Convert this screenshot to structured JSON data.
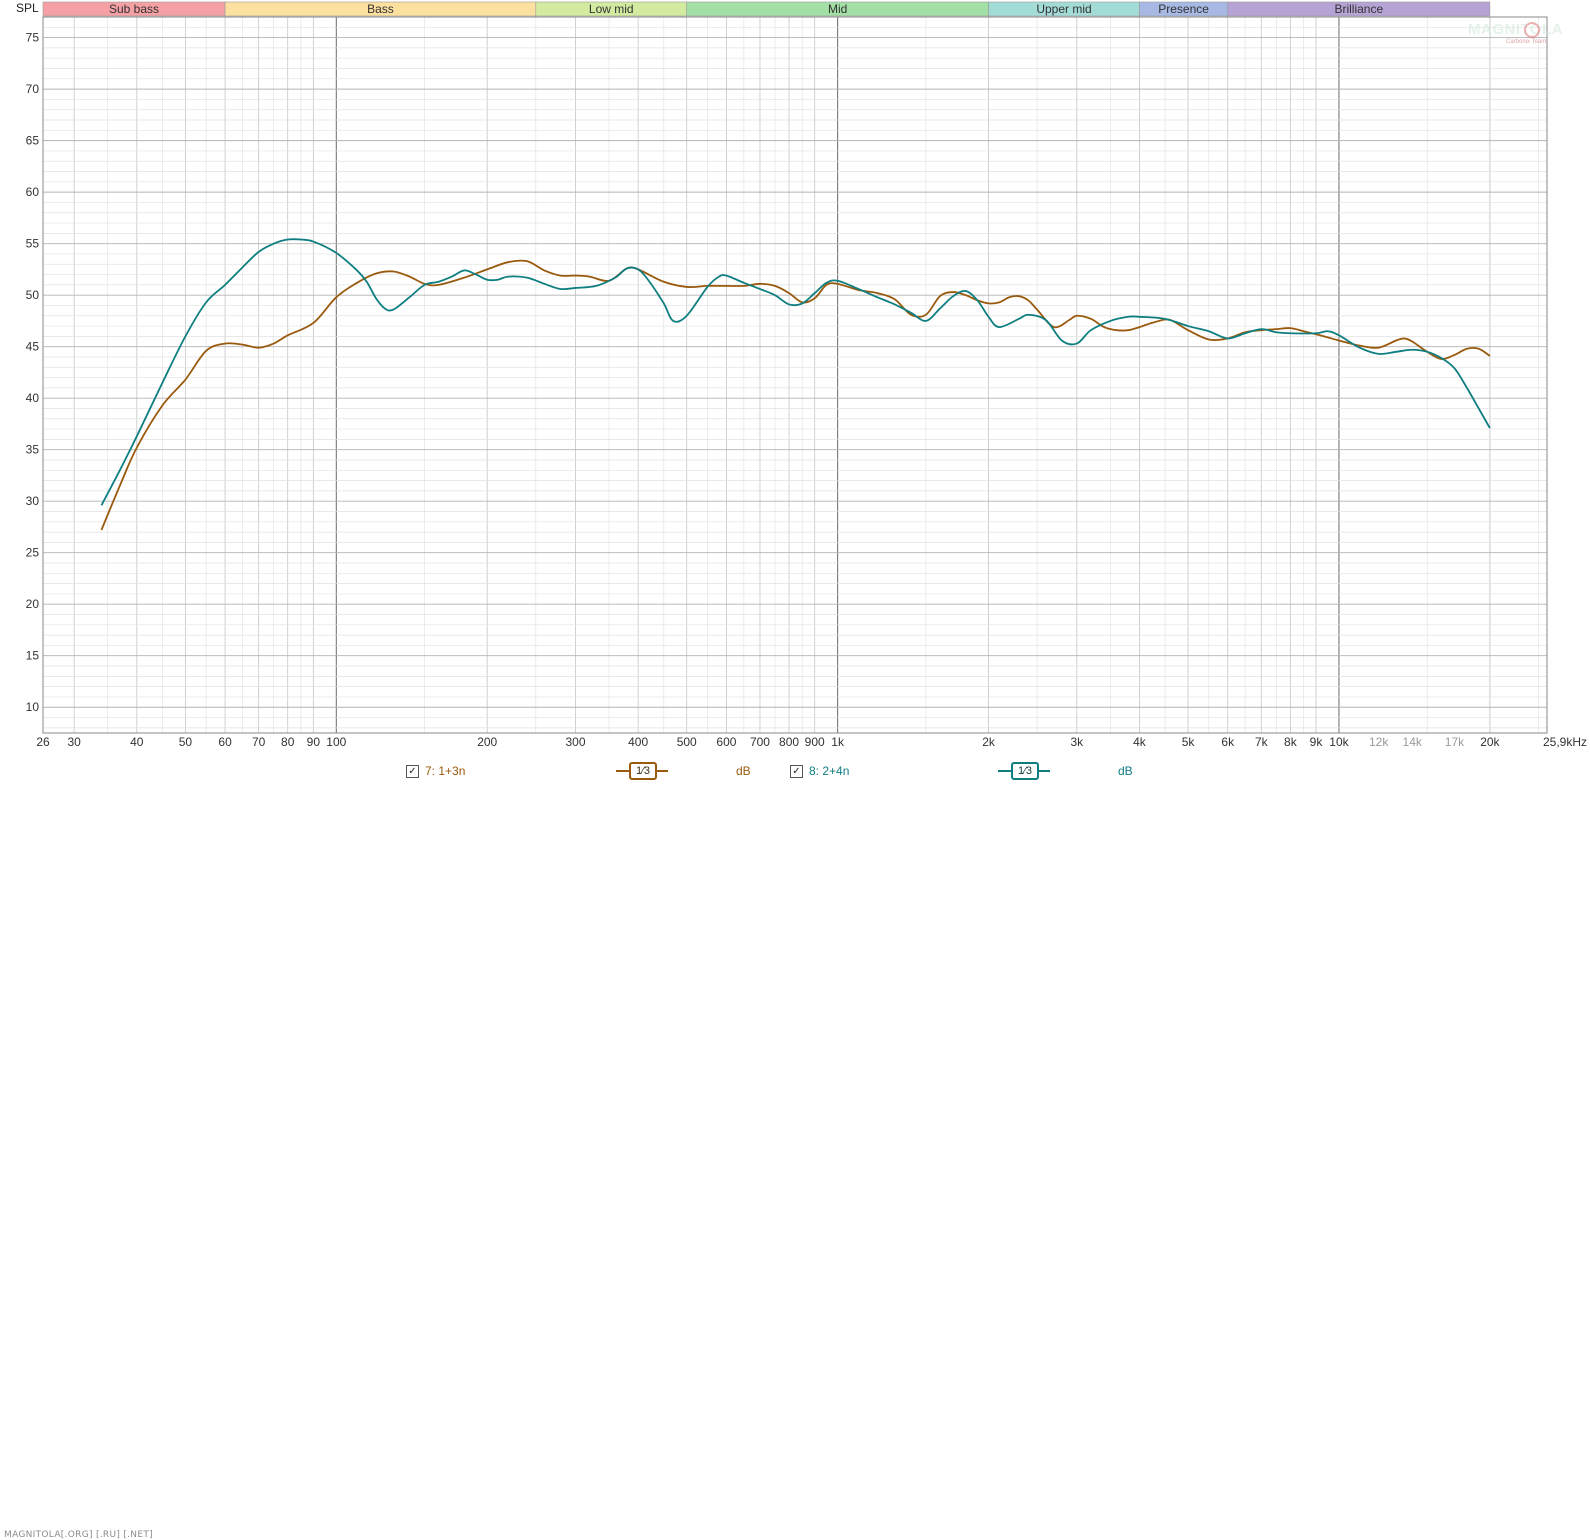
{
  "chart_data": {
    "type": "line",
    "y_axis_label": "SPL",
    "x_scale": "log",
    "xlim": [
      26,
      26000
    ],
    "ylim": [
      7.5,
      77
    ],
    "y_ticks": [
      10,
      15,
      20,
      25,
      30,
      35,
      40,
      45,
      50,
      55,
      60,
      65,
      70,
      75
    ],
    "x_tick_labels": [
      {
        "value": 26,
        "label": "26"
      },
      {
        "value": 30,
        "label": "30"
      },
      {
        "value": 40,
        "label": "40"
      },
      {
        "value": 50,
        "label": "50"
      },
      {
        "value": 60,
        "label": "60"
      },
      {
        "value": 70,
        "label": "70"
      },
      {
        "value": 80,
        "label": "80"
      },
      {
        "value": 90,
        "label": "90"
      },
      {
        "value": 100,
        "label": "100"
      },
      {
        "value": 200,
        "label": "200"
      },
      {
        "value": 300,
        "label": "300"
      },
      {
        "value": 400,
        "label": "400"
      },
      {
        "value": 500,
        "label": "500"
      },
      {
        "value": 600,
        "label": "600"
      },
      {
        "value": 700,
        "label": "700"
      },
      {
        "value": 800,
        "label": "800"
      },
      {
        "value": 900,
        "label": "900"
      },
      {
        "value": 1000,
        "label": "1k"
      },
      {
        "value": 2000,
        "label": "2k"
      },
      {
        "value": 3000,
        "label": "3k"
      },
      {
        "value": 4000,
        "label": "4k"
      },
      {
        "value": 5000,
        "label": "5k"
      },
      {
        "value": 6000,
        "label": "6k"
      },
      {
        "value": 7000,
        "label": "7k"
      },
      {
        "value": 8000,
        "label": "8k"
      },
      {
        "value": 9000,
        "label": "9k"
      },
      {
        "value": 10000,
        "label": "10k"
      },
      {
        "value": 12000,
        "label": "12k",
        "dim": true
      },
      {
        "value": 14000,
        "label": "14k",
        "dim": true
      },
      {
        "value": 17000,
        "label": "17k",
        "dim": true
      },
      {
        "value": 20000,
        "label": "20k"
      },
      {
        "value": 25900,
        "label": "25,9kHz"
      }
    ],
    "bands": [
      {
        "name": "Sub bass",
        "from": 26,
        "to": 60,
        "color": "#f4a0a4"
      },
      {
        "name": "Bass",
        "from": 60,
        "to": 250,
        "color": "#fce0a0"
      },
      {
        "name": "Low mid",
        "from": 250,
        "to": 500,
        "color": "#d2eba0"
      },
      {
        "name": "Mid",
        "from": 500,
        "to": 2000,
        "color": "#a3e0a6"
      },
      {
        "name": "Upper mid",
        "from": 2000,
        "to": 4000,
        "color": "#a3dcd6"
      },
      {
        "name": "Presence",
        "from": 4000,
        "to": 6000,
        "color": "#a6b8e3"
      },
      {
        "name": "Brilliance",
        "from": 6000,
        "to": 20000,
        "color": "#b6a3d6"
      }
    ],
    "series": [
      {
        "name": "7: 1+3n",
        "color": "#9a5a0e",
        "points": [
          [
            34,
            27.2
          ],
          [
            37,
            31.5
          ],
          [
            40,
            35.2
          ],
          [
            45,
            39.3
          ],
          [
            50,
            41.8
          ],
          [
            55,
            44.6
          ],
          [
            60,
            45.3
          ],
          [
            65,
            45.2
          ],
          [
            70,
            44.9
          ],
          [
            75,
            45.3
          ],
          [
            80,
            46.1
          ],
          [
            90,
            47.3
          ],
          [
            100,
            49.8
          ],
          [
            110,
            51.2
          ],
          [
            120,
            52.1
          ],
          [
            130,
            52.3
          ],
          [
            140,
            51.8
          ],
          [
            150,
            51.1
          ],
          [
            160,
            51.0
          ],
          [
            180,
            51.7
          ],
          [
            200,
            52.5
          ],
          [
            220,
            53.2
          ],
          [
            240,
            53.3
          ],
          [
            260,
            52.4
          ],
          [
            280,
            51.9
          ],
          [
            300,
            51.9
          ],
          [
            320,
            51.8
          ],
          [
            350,
            51.4
          ],
          [
            380,
            52.6
          ],
          [
            400,
            52.5
          ],
          [
            450,
            51.3
          ],
          [
            500,
            50.8
          ],
          [
            550,
            50.9
          ],
          [
            600,
            50.9
          ],
          [
            650,
            50.9
          ],
          [
            700,
            51.1
          ],
          [
            750,
            50.9
          ],
          [
            800,
            50.2
          ],
          [
            850,
            49.3
          ],
          [
            900,
            49.7
          ],
          [
            950,
            51.0
          ],
          [
            1000,
            51.1
          ],
          [
            1100,
            50.5
          ],
          [
            1200,
            50.2
          ],
          [
            1300,
            49.6
          ],
          [
            1400,
            48.1
          ],
          [
            1500,
            48.1
          ],
          [
            1600,
            49.9
          ],
          [
            1700,
            50.3
          ],
          [
            1800,
            50.0
          ],
          [
            1900,
            49.5
          ],
          [
            2000,
            49.2
          ],
          [
            2100,
            49.3
          ],
          [
            2200,
            49.8
          ],
          [
            2300,
            49.9
          ],
          [
            2400,
            49.5
          ],
          [
            2500,
            48.6
          ],
          [
            2700,
            46.9
          ],
          [
            2900,
            47.6
          ],
          [
            3000,
            48.0
          ],
          [
            3200,
            47.7
          ],
          [
            3400,
            46.9
          ],
          [
            3600,
            46.6
          ],
          [
            3800,
            46.6
          ],
          [
            4000,
            46.9
          ],
          [
            4300,
            47.4
          ],
          [
            4600,
            47.6
          ],
          [
            5000,
            46.6
          ],
          [
            5500,
            45.7
          ],
          [
            6000,
            45.8
          ],
          [
            6500,
            46.4
          ],
          [
            7000,
            46.6
          ],
          [
            7500,
            46.7
          ],
          [
            8000,
            46.8
          ],
          [
            8500,
            46.5
          ],
          [
            9000,
            46.2
          ],
          [
            9500,
            45.9
          ],
          [
            10000,
            45.6
          ],
          [
            11000,
            45.1
          ],
          [
            12000,
            44.9
          ],
          [
            13000,
            45.6
          ],
          [
            13500,
            45.8
          ],
          [
            14000,
            45.5
          ],
          [
            15000,
            44.5
          ],
          [
            16000,
            43.8
          ],
          [
            17000,
            44.2
          ],
          [
            18000,
            44.8
          ],
          [
            19000,
            44.8
          ],
          [
            20000,
            44.1
          ]
        ]
      },
      {
        "name": "8: 2+4n",
        "color": "#0e7e80",
        "points": [
          [
            34,
            29.6
          ],
          [
            37,
            33.0
          ],
          [
            40,
            36.3
          ],
          [
            45,
            41.5
          ],
          [
            50,
            46.0
          ],
          [
            55,
            49.3
          ],
          [
            60,
            51.0
          ],
          [
            65,
            52.7
          ],
          [
            70,
            54.2
          ],
          [
            75,
            55.0
          ],
          [
            80,
            55.4
          ],
          [
            85,
            55.4
          ],
          [
            90,
            55.2
          ],
          [
            100,
            54.1
          ],
          [
            110,
            52.4
          ],
          [
            115,
            51.3
          ],
          [
            120,
            49.7
          ],
          [
            125,
            48.7
          ],
          [
            130,
            48.6
          ],
          [
            140,
            49.8
          ],
          [
            150,
            51.0
          ],
          [
            160,
            51.3
          ],
          [
            170,
            51.8
          ],
          [
            180,
            52.4
          ],
          [
            190,
            52.0
          ],
          [
            200,
            51.5
          ],
          [
            210,
            51.5
          ],
          [
            220,
            51.8
          ],
          [
            240,
            51.7
          ],
          [
            260,
            51.1
          ],
          [
            280,
            50.6
          ],
          [
            300,
            50.7
          ],
          [
            330,
            50.9
          ],
          [
            360,
            51.7
          ],
          [
            380,
            52.6
          ],
          [
            400,
            52.5
          ],
          [
            420,
            51.4
          ],
          [
            450,
            49.2
          ],
          [
            470,
            47.5
          ],
          [
            500,
            48.0
          ],
          [
            550,
            50.8
          ],
          [
            580,
            51.8
          ],
          [
            600,
            51.9
          ],
          [
            650,
            51.2
          ],
          [
            700,
            50.6
          ],
          [
            750,
            50.0
          ],
          [
            800,
            49.1
          ],
          [
            850,
            49.2
          ],
          [
            900,
            50.2
          ],
          [
            950,
            51.2
          ],
          [
            1000,
            51.4
          ],
          [
            1100,
            50.6
          ],
          [
            1200,
            49.8
          ],
          [
            1300,
            49.1
          ],
          [
            1400,
            48.3
          ],
          [
            1500,
            47.5
          ],
          [
            1600,
            48.7
          ],
          [
            1700,
            49.9
          ],
          [
            1800,
            50.4
          ],
          [
            1900,
            49.5
          ],
          [
            2000,
            47.9
          ],
          [
            2100,
            46.9
          ],
          [
            2300,
            47.7
          ],
          [
            2400,
            48.1
          ],
          [
            2600,
            47.6
          ],
          [
            2800,
            45.6
          ],
          [
            3000,
            45.3
          ],
          [
            3200,
            46.6
          ],
          [
            3500,
            47.5
          ],
          [
            3800,
            47.9
          ],
          [
            4000,
            47.9
          ],
          [
            4500,
            47.7
          ],
          [
            5000,
            47.0
          ],
          [
            5500,
            46.5
          ],
          [
            6000,
            45.8
          ],
          [
            6500,
            46.3
          ],
          [
            7000,
            46.7
          ],
          [
            7500,
            46.4
          ],
          [
            8000,
            46.3
          ],
          [
            9000,
            46.3
          ],
          [
            9500,
            46.5
          ],
          [
            10000,
            46.1
          ],
          [
            11000,
            44.9
          ],
          [
            12000,
            44.3
          ],
          [
            13000,
            44.5
          ],
          [
            14000,
            44.7
          ],
          [
            15000,
            44.5
          ],
          [
            16000,
            43.9
          ],
          [
            17000,
            42.9
          ],
          [
            18000,
            41.0
          ],
          [
            19000,
            39.0
          ],
          [
            20000,
            37.1
          ]
        ]
      }
    ]
  },
  "legend": [
    {
      "checkbox": "✓",
      "name": "7: 1+3n",
      "smoothing": "1⁄3",
      "unit": "dB",
      "color": "#9a5a0e"
    },
    {
      "checkbox": "✓",
      "name": "8: 2+4n",
      "smoothing": "1⁄3",
      "unit": "dB",
      "color": "#0e7e80"
    }
  ],
  "footer": {
    "watermark": "MAGNITOLA[.ORG] [.RU] [.NET]"
  },
  "logo": {
    "wordmark": "MAGNITOLA",
    "tagline": "Carbonix Team"
  }
}
